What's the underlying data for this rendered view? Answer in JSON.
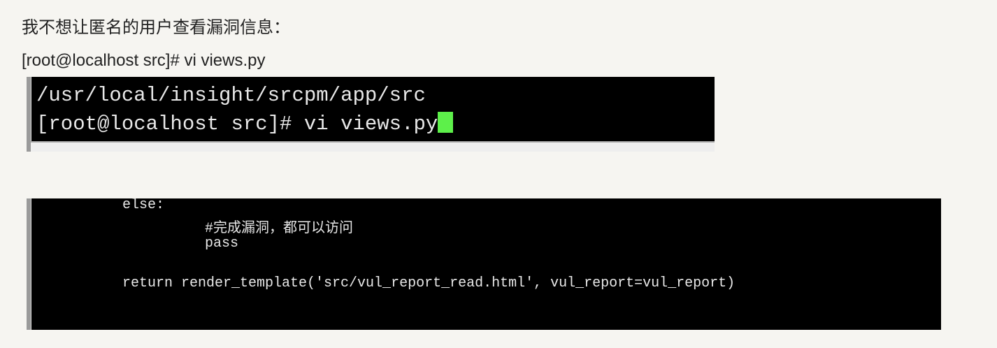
{
  "text": {
    "intro": "我不想让匿名的用户查看漏洞信息：",
    "command": "[root@localhost src]# vi views.py"
  },
  "terminal1": {
    "lines": [
      "/usr/local/insight/srcpm/app/src",
      "[root@localhost src]# vi views.py"
    ],
    "cursor_color": "#5df04a"
  },
  "terminal2": {
    "lines": [
      "else:",
      "#完成漏洞，都可以访问",
      "pass",
      "return render_template('src/vul_report_read.html', vul_report=vul_report)"
    ]
  }
}
